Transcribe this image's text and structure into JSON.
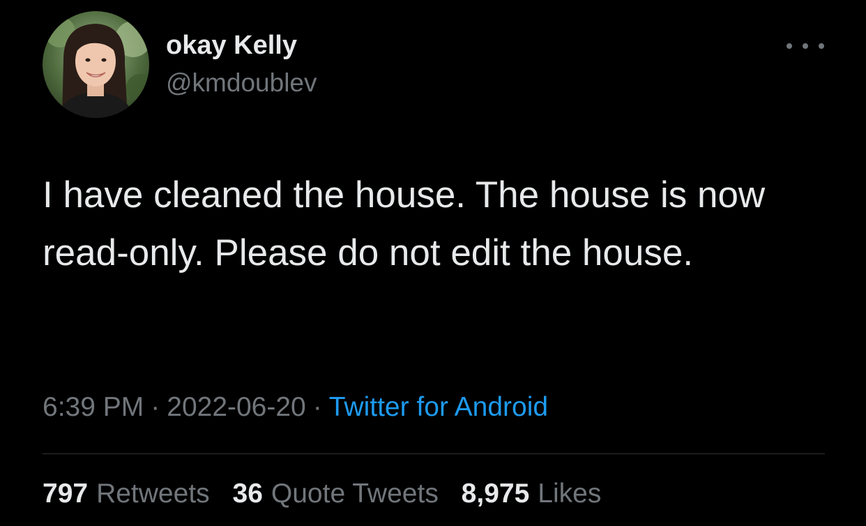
{
  "author": {
    "display_name": "okay Kelly",
    "handle": "@kmdoublev"
  },
  "tweet": {
    "text": "I have cleaned the house. The house is now read-only. Please do not edit the house.",
    "time": "6:39 PM",
    "date": "2022-06-20",
    "separator": "·",
    "source": "Twitter for Android"
  },
  "stats": {
    "retweets": {
      "count": "797",
      "label": "Retweets"
    },
    "quotes": {
      "count": "36",
      "label": "Quote Tweets"
    },
    "likes": {
      "count": "8,975",
      "label": "Likes"
    }
  },
  "icons": {
    "more": "more-horizontal-icon"
  },
  "colors": {
    "background": "#000000",
    "primary_text": "#e7e9ea",
    "secondary_text": "#71767b",
    "link": "#1d9bf0",
    "divider": "#2f3336"
  }
}
